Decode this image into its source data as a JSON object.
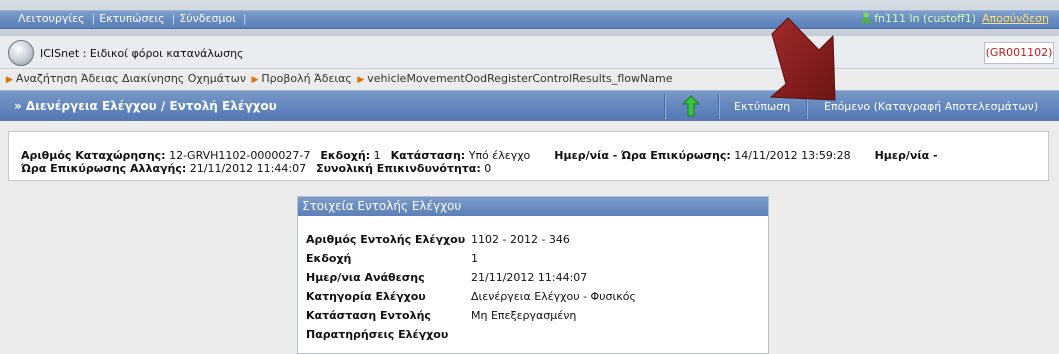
{
  "menu": {
    "items": [
      "Λειτουργίες",
      "Εκτυπώσεις",
      "Σύνδεσμοι"
    ]
  },
  "user": {
    "name": "fn111 ln (custoff1)",
    "logout_label": "Αποσύνδεση"
  },
  "app": {
    "title": "ICISnet : Ειδικοί φόροι κατανάλωσης",
    "code": "(GR001102)"
  },
  "breadcrumb": {
    "items": [
      "Αναζήτηση Άδειας Διακίνησης Οχημάτων",
      "Προβολή Άδειας",
      "vehicleMovementOodRegisterControlResults_flowName"
    ]
  },
  "toolbar": {
    "page_title": "» Διενέργεια Ελέγχου / Εντολή Ελέγχου",
    "print_label": "Εκτύπωση",
    "next_label": "Επόμενο (Καταγραφή Αποτελεσμάτων)"
  },
  "summary": {
    "reg_label": "Αριθμός Καταχώρησης:",
    "reg_value": "12-GRVH1102-0000027-7",
    "version_label": "Εκδοχή:",
    "version_value": "1",
    "status_label": "Κατάσταση:",
    "status_value": "Υπό έλεγχο",
    "validation_date_label": "Ημερ/νία - Ώρα Επικύρωσης:",
    "validation_date_value": "14/11/2012 13:59:28",
    "change_date_label_part1": "Ημερ/νία -",
    "change_date_label_part2": "Ώρα Επικύρωσης Αλλαγής:",
    "change_date_value": "21/11/2012 11:44:07",
    "risk_label": "Συνολική Επικινδυνότητα:",
    "risk_value": "0"
  },
  "control_order": {
    "header": "Στοιχεία Εντολής Ελέγχου",
    "rows": [
      {
        "label": "Αριθμός Εντολής Ελέγχου",
        "value": "1102 - 2012 - 346"
      },
      {
        "label": "Εκδοχή",
        "value": "1"
      },
      {
        "label": "Ημερ/νια Ανάθεσης",
        "value": "21/11/2012 11:44:07"
      },
      {
        "label": "Κατηγορία Ελέγχου",
        "value": "Διενέργεια Ελέγχου - Φυσικός"
      },
      {
        "label": "Κατάσταση Εντολής",
        "value": "Μη Επεξεργασμένη"
      },
      {
        "label": "Παρατηρήσεις Ελέγχου",
        "value": ""
      }
    ]
  },
  "colors": {
    "accent_blue": "#6185bd",
    "code_red": "#c41b1b",
    "annotation_arrow": "#8e1f1f"
  }
}
